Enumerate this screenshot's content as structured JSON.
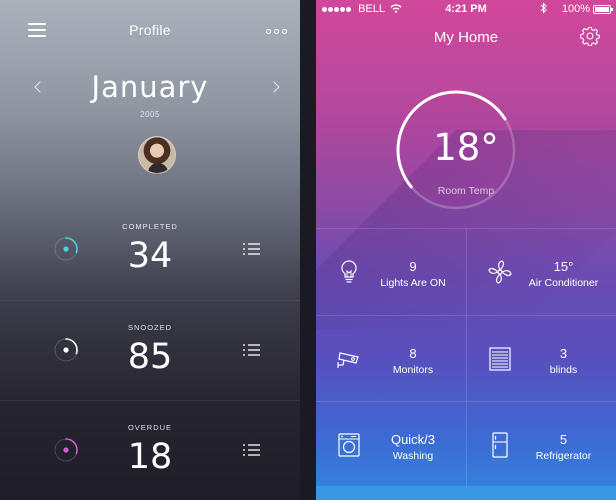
{
  "profile_screen": {
    "title": "Profile",
    "month": "January",
    "year": "2005",
    "stats": [
      {
        "label": "COMPLETED",
        "value": "34",
        "ring_color": "#4fd1d9",
        "ring_progress": 0.3
      },
      {
        "label": "SNOOZED",
        "value": "85",
        "ring_color": "#ffffff",
        "ring_progress": 0.3
      },
      {
        "label": "OVERDUE",
        "value": "18",
        "ring_color": "#d65bd6",
        "ring_progress": 0.3
      }
    ]
  },
  "home_screen": {
    "status_bar": {
      "carrier": "BELL",
      "time": "4:21 PM",
      "battery": "100%"
    },
    "title": "My Home",
    "temperature": {
      "value": "18°",
      "label": "Room Temp",
      "dial_level": 0.52
    },
    "devices": [
      {
        "icon": "lightbulb-icon",
        "count": "9",
        "name": "Lights Are ON"
      },
      {
        "icon": "fan-icon",
        "count": "15°",
        "name": "Air Conditioner"
      },
      {
        "icon": "camera-icon",
        "count": "8",
        "name": "Monitors"
      },
      {
        "icon": "blinds-icon",
        "count": "3",
        "name": "blinds"
      },
      {
        "icon": "washing-machine-icon",
        "count": "Quick/3",
        "name": "Washing"
      },
      {
        "icon": "refrigerator-icon",
        "count": "5",
        "name": "Refrigerator"
      }
    ]
  },
  "colors": {
    "home_gradient_top": "#d1479b",
    "home_gradient_bottom": "#3486de",
    "completed_accent": "#4fd1d9",
    "overdue_accent": "#d65bd6"
  }
}
